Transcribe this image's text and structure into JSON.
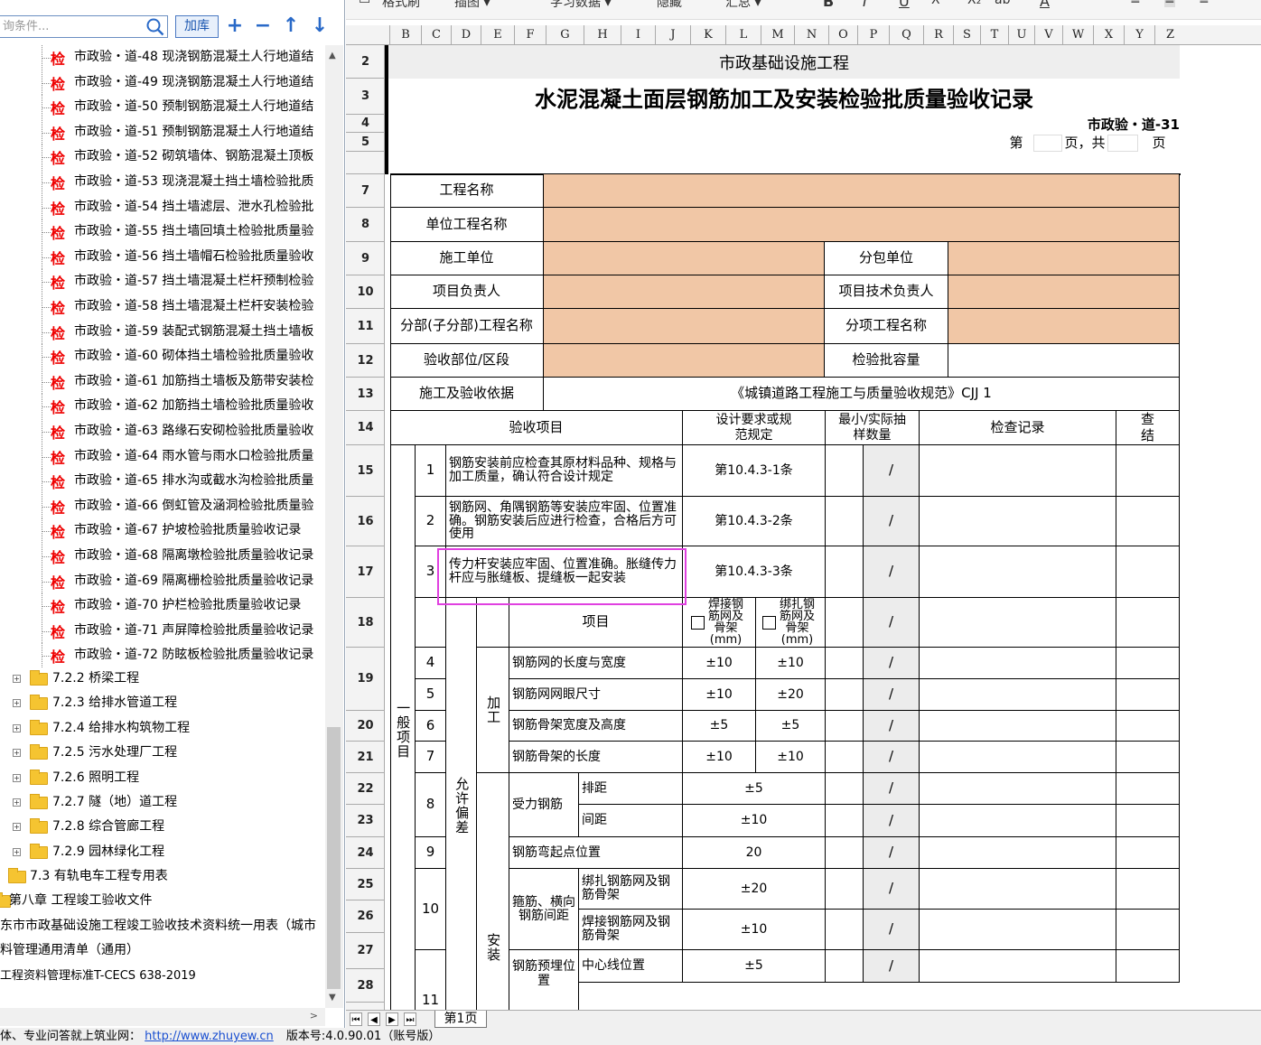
{
  "left_panel": {
    "search_placeholder": "询条件...",
    "add_lib_label": "加库",
    "tools": [
      "+",
      "−",
      "↑",
      "↓"
    ],
    "inspection_items": [
      "市政验・道-48 现浇钢筋混凝土人行地道结",
      "市政验・道-49 现浇钢筋混凝土人行地道结",
      "市政验・道-50 预制钢筋混凝土人行地道结",
      "市政验・道-51 预制钢筋混凝土人行地道结",
      "市政验・道-52 砌筑墙体、钢筋混凝土顶板",
      "市政验・道-53 现浇混凝土挡土墙检验批质",
      "市政验・道-54 挡土墙滤层、泄水孔检验批",
      "市政验・道-55 挡土墙回填土检验批质量验",
      "市政验・道-56 挡土墙帽石检验批质量验收",
      "市政验・道-57 挡土墙混凝土栏杆预制检验",
      "市政验・道-58 挡土墙混凝土栏杆安装检验",
      "市政验・道-59 装配式钢筋混凝土挡土墙板",
      "市政验・道-60 砌体挡土墙检验批质量验收",
      "市政验・道-61 加筋挡土墙板及筋带安装检",
      "市政验・道-62 加筋挡土墙检验批质量验收",
      "市政验・道-63 路缘石安砌检验批质量验收",
      "市政验・道-64 雨水管与雨水口检验批质量",
      "市政验・道-65 排水沟或截水沟检验批质量",
      "市政验・道-66 倒虹管及涵洞检验批质量验",
      "市政验・道-67 护坡检验批质量验收记录",
      "市政验・道-68 隔离墩检验批质量验收记录",
      "市政验・道-69 隔离栅检验批质量验收记录",
      "市政验・道-70 护栏检验批质量验收记录",
      "市政验・道-71 声屏障检验批质量验收记录",
      "市政验・道-72 防眩板检验批质量验收记录"
    ],
    "check_mark": "检",
    "sections": [
      "7.2.2 桥梁工程",
      "7.2.3 给排水管道工程",
      "7.2.4 给排水构筑物工程",
      "7.2.5 污水处理厂工程",
      "7.2.6 照明工程",
      "7.2.7 隧（地）道工程",
      "7.2.8 综合管廊工程",
      "7.2.9 园林绿化工程"
    ],
    "section_73": "7.3 有轨电车工程专用表",
    "chapter8": "第八章 工程竣工验收文件",
    "extra1": "东市市政基础设施工程竣工验收技术资料统一用表（城市",
    "extra2": "料管理通用清单（通用）",
    "extra3": "工程资料管理标准T-CECS 638-2019"
  },
  "toolbar": {
    "items": [
      "格式刷",
      "插图 ▾",
      "学习数据 ▾",
      "隐藏",
      "汇总 ▾"
    ],
    "format_glyphs": [
      "B",
      "I",
      "U",
      "X²",
      "X₂",
      "ab",
      "A"
    ]
  },
  "columns": [
    "B",
    "C",
    "D",
    "E",
    "F",
    "G",
    "H",
    "I",
    "J",
    "K",
    "L",
    "M",
    "N",
    "O",
    "P",
    "Q",
    "R",
    "S",
    "T",
    "U",
    "V",
    "W",
    "X",
    "Y",
    "Z"
  ],
  "rows": [
    "2",
    "3",
    "4",
    "5",
    "7",
    "8",
    "9",
    "10",
    "11",
    "12",
    "13",
    "14",
    "15",
    "16",
    "17",
    "18",
    "19",
    "20",
    "21",
    "22",
    "23",
    "24",
    "25",
    "26",
    "27",
    "28"
  ],
  "form": {
    "subtitle": "市政基础设施工程",
    "title": "水泥混凝土面层钢筋加工及安装检验批质量验收记录",
    "code": "市政验・道-31",
    "page_prefix": "第",
    "page_mid": "页，共",
    "page_suffix": "页",
    "project_name": "工程名称",
    "unit_project": "单位工程名称",
    "contractor": "施工单位",
    "subcontractor": "分包单位",
    "project_manager": "项目负责人",
    "tech_manager": "项目技术负责人",
    "division_name": "分部(子分部)工程名称",
    "subitem_name": "分项工程名称",
    "inspection_section": "验收部位/区段",
    "batch_capacity": "检验批容量",
    "basis_label": "施工及验收依据",
    "basis_value": "《城镇道路工程施工与质量验收规范》CJJ 1",
    "hdr_item": "验收项目",
    "hdr_design": "设计要求或规范规定",
    "hdr_sample": "最小/实际抽样数量",
    "hdr_record": "检查记录",
    "hdr_result": "检查结果",
    "general": "一般项目",
    "allowed": "允许偏差",
    "process": "加工",
    "install": "安装",
    "slash": "/",
    "r15": {
      "no": "1",
      "text": "钢筋安装前应检查其原材料品种、规格与加工质量，确认符合设计规定",
      "clause": "第10.4.3-1条"
    },
    "r16": {
      "no": "2",
      "text": "钢筋网、角隅钢筋等安装应牢固、位置准确。钢筋安装后应进行检查，合格后方可使用",
      "clause": "第10.4.3-2条"
    },
    "r17": {
      "no": "3",
      "text": "传力杆安装应牢固、位置准确。胀缝传力杆应与胀缝板、提缝板一起安装",
      "clause": "第10.4.3-3条"
    },
    "r18": {
      "item": "项目",
      "welded": "焊接钢筋网及骨架(mm)",
      "bound": "绑扎钢筋网及骨架(mm)"
    },
    "r19": {
      "no": "4",
      "text": "钢筋网的长度与宽度",
      "a": "±10",
      "b": "±10"
    },
    "r20": {
      "no": "5",
      "text": "钢筋网网眼尺寸",
      "a": "±10",
      "b": "±20"
    },
    "r21": {
      "no": "6",
      "text": "钢筋骨架宽度及高度",
      "a": "±5",
      "b": "±5"
    },
    "r22": {
      "no": "7",
      "text": "钢筋骨架的长度",
      "a": "±10",
      "b": "±10"
    },
    "r23": {
      "no": "8",
      "main": "受力钢筋",
      "sub": "排距",
      "v": "±5"
    },
    "r24": {
      "sub": "间距",
      "v": "±10"
    },
    "r25": {
      "no": "9",
      "text": "钢筋弯起点位置",
      "v": "20"
    },
    "r26": {
      "no": "10",
      "main": "箍筋、横向钢筋间距",
      "sub": "绑扎钢筋网及钢筋骨架",
      "v": "±20"
    },
    "r27": {
      "sub": "焊接钢筋网及钢筋骨架",
      "v": "±10"
    },
    "r28": {
      "no": "11",
      "main": "钢筋预埋位置",
      "sub": "中心线位置",
      "v": "±5"
    }
  },
  "sheet_tab": "第1页",
  "status": {
    "prefix": "体、专业问答就上筑业网：",
    "url": "http://www.zhuyew.cn",
    "version": "版本号:4.0.90.01（账号版）"
  },
  "colors": {
    "peach": "#f1c7a6",
    "highlight": "#e040e0",
    "check": "#e00000"
  }
}
